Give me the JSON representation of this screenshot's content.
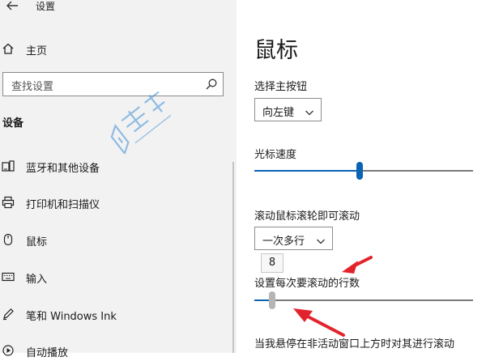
{
  "window": {
    "title": "设置"
  },
  "sidebar": {
    "home_label": "主页",
    "search_placeholder": "查找设置",
    "section_title": "设备",
    "items": [
      {
        "label": "蓝牙和其他设备",
        "icon": "bluetooth-devices-icon"
      },
      {
        "label": "打印机和扫描仪",
        "icon": "printer-icon"
      },
      {
        "label": "鼠标",
        "icon": "mouse-icon"
      },
      {
        "label": "输入",
        "icon": "keyboard-icon"
      },
      {
        "label": "笔和 Windows Ink",
        "icon": "pen-icon"
      },
      {
        "label": "自动播放",
        "icon": "autoplay-icon"
      }
    ]
  },
  "main": {
    "title": "鼠标",
    "primary_button": {
      "label": "选择主按钮",
      "value": "向左键"
    },
    "cursor_speed": {
      "label": "光标速度",
      "fraction": 0.48
    },
    "wheel_scroll": {
      "label": "滚动鼠标滚轮即可滚动",
      "value": "一次多行"
    },
    "lines_to_scroll": {
      "label": "设置每次要滚动的行数",
      "value": "8",
      "fraction": 0.08
    },
    "inactive_scroll": {
      "label": "当我悬停在非活动窗口上方时对其进行滚动"
    }
  },
  "colors": {
    "accent": "#0a63b3",
    "annotation_arrow": "#e3232c",
    "sidebar_bg": "#f2f2f2"
  }
}
